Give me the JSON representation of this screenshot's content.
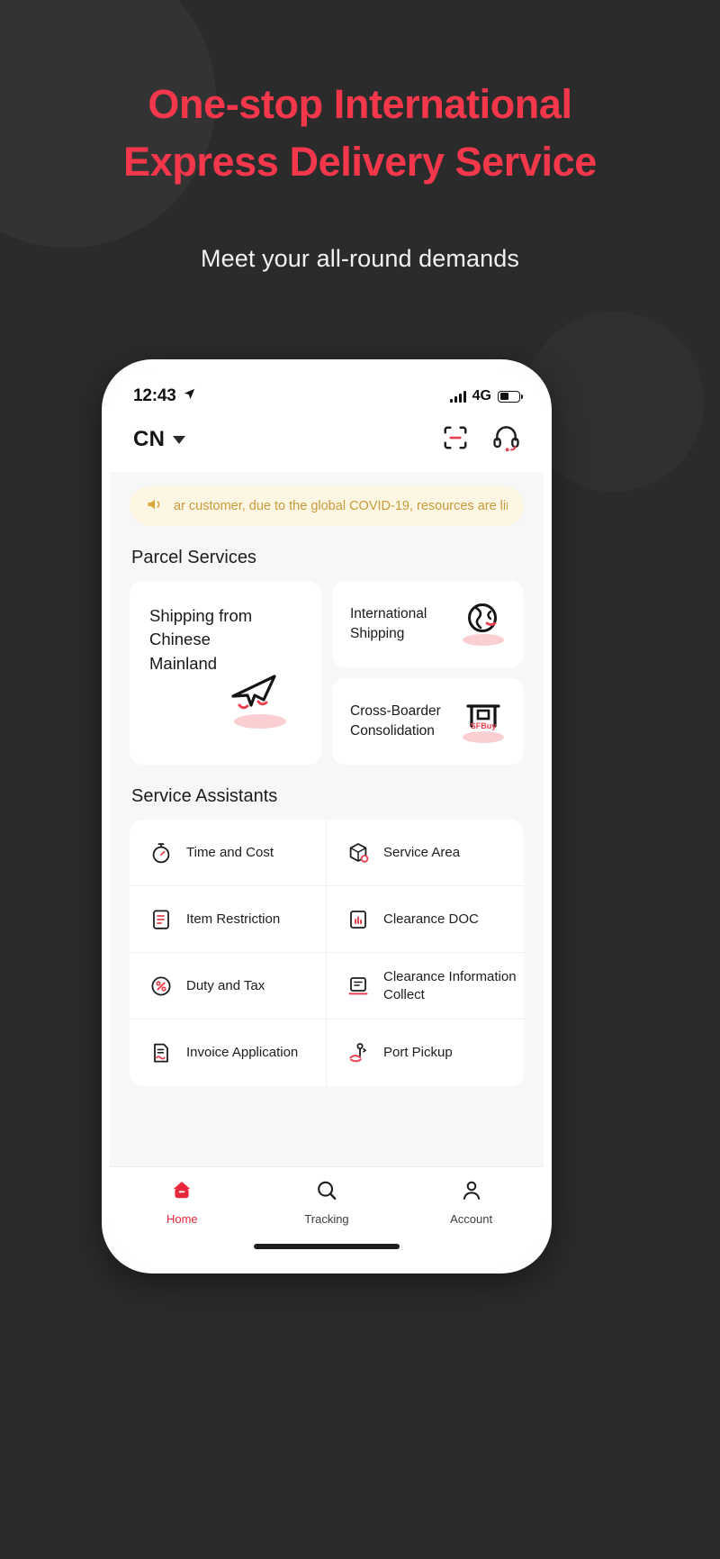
{
  "hero": {
    "title_line1": "One-stop International",
    "title_line2": "Express Delivery Service",
    "subtitle": "Meet your all-round demands",
    "accent_color": "#f5374b",
    "background_color": "#2b2b2b"
  },
  "phone": {
    "status_bar": {
      "time": "12:43",
      "location_icon": "location-arrow-icon",
      "network": "4G",
      "signal_icon": "signal-bars-icon",
      "battery_icon": "battery-icon",
      "battery_level_percent": 45
    },
    "app_header": {
      "region_code": "CN",
      "region_caret": "chevron-down-icon",
      "scan_icon": "scan-code-icon",
      "support_icon": "headset-icon"
    },
    "notice": {
      "speaker_icon": "speaker-icon",
      "text": "ar customer, due to the global COVID-19, resources are lin",
      "background_color": "#fdf6e3",
      "text_color": "#c79a3a"
    },
    "parcel_services": {
      "title": "Parcel Services",
      "cards": [
        {
          "label": "Shipping from Chinese Mainland",
          "icon": "paper-plane-illustration",
          "size": "large"
        },
        {
          "label": "International Shipping",
          "icon": "globe-illustration",
          "size": "small"
        },
        {
          "label": "Cross-Boarder Consolidation",
          "icon": "sfbuy-storefront-illustration",
          "size": "small",
          "badge_text": "SFBuy"
        }
      ]
    },
    "service_assistants": {
      "title": "Service Assistants",
      "items": [
        {
          "label": "Time and Cost",
          "icon": "stopwatch-icon"
        },
        {
          "label": "Service Area",
          "icon": "box-location-icon"
        },
        {
          "label": "Item Restriction",
          "icon": "clipboard-list-icon"
        },
        {
          "label": "Clearance DOC",
          "icon": "chart-document-icon"
        },
        {
          "label": "Duty and Tax",
          "icon": "percent-circle-icon"
        },
        {
          "label": "Clearance Information Collect",
          "icon": "document-scan-icon"
        },
        {
          "label": "Invoice Application",
          "icon": "invoice-icon"
        },
        {
          "label": "Port Pickup",
          "icon": "hand-pin-icon"
        }
      ]
    },
    "tab_bar": {
      "active_color": "#e8263c",
      "tabs": [
        {
          "label": "Home",
          "icon": "home-icon",
          "active": true
        },
        {
          "label": "Tracking",
          "icon": "search-icon",
          "active": false
        },
        {
          "label": "Account",
          "icon": "person-icon",
          "active": false
        }
      ]
    }
  }
}
